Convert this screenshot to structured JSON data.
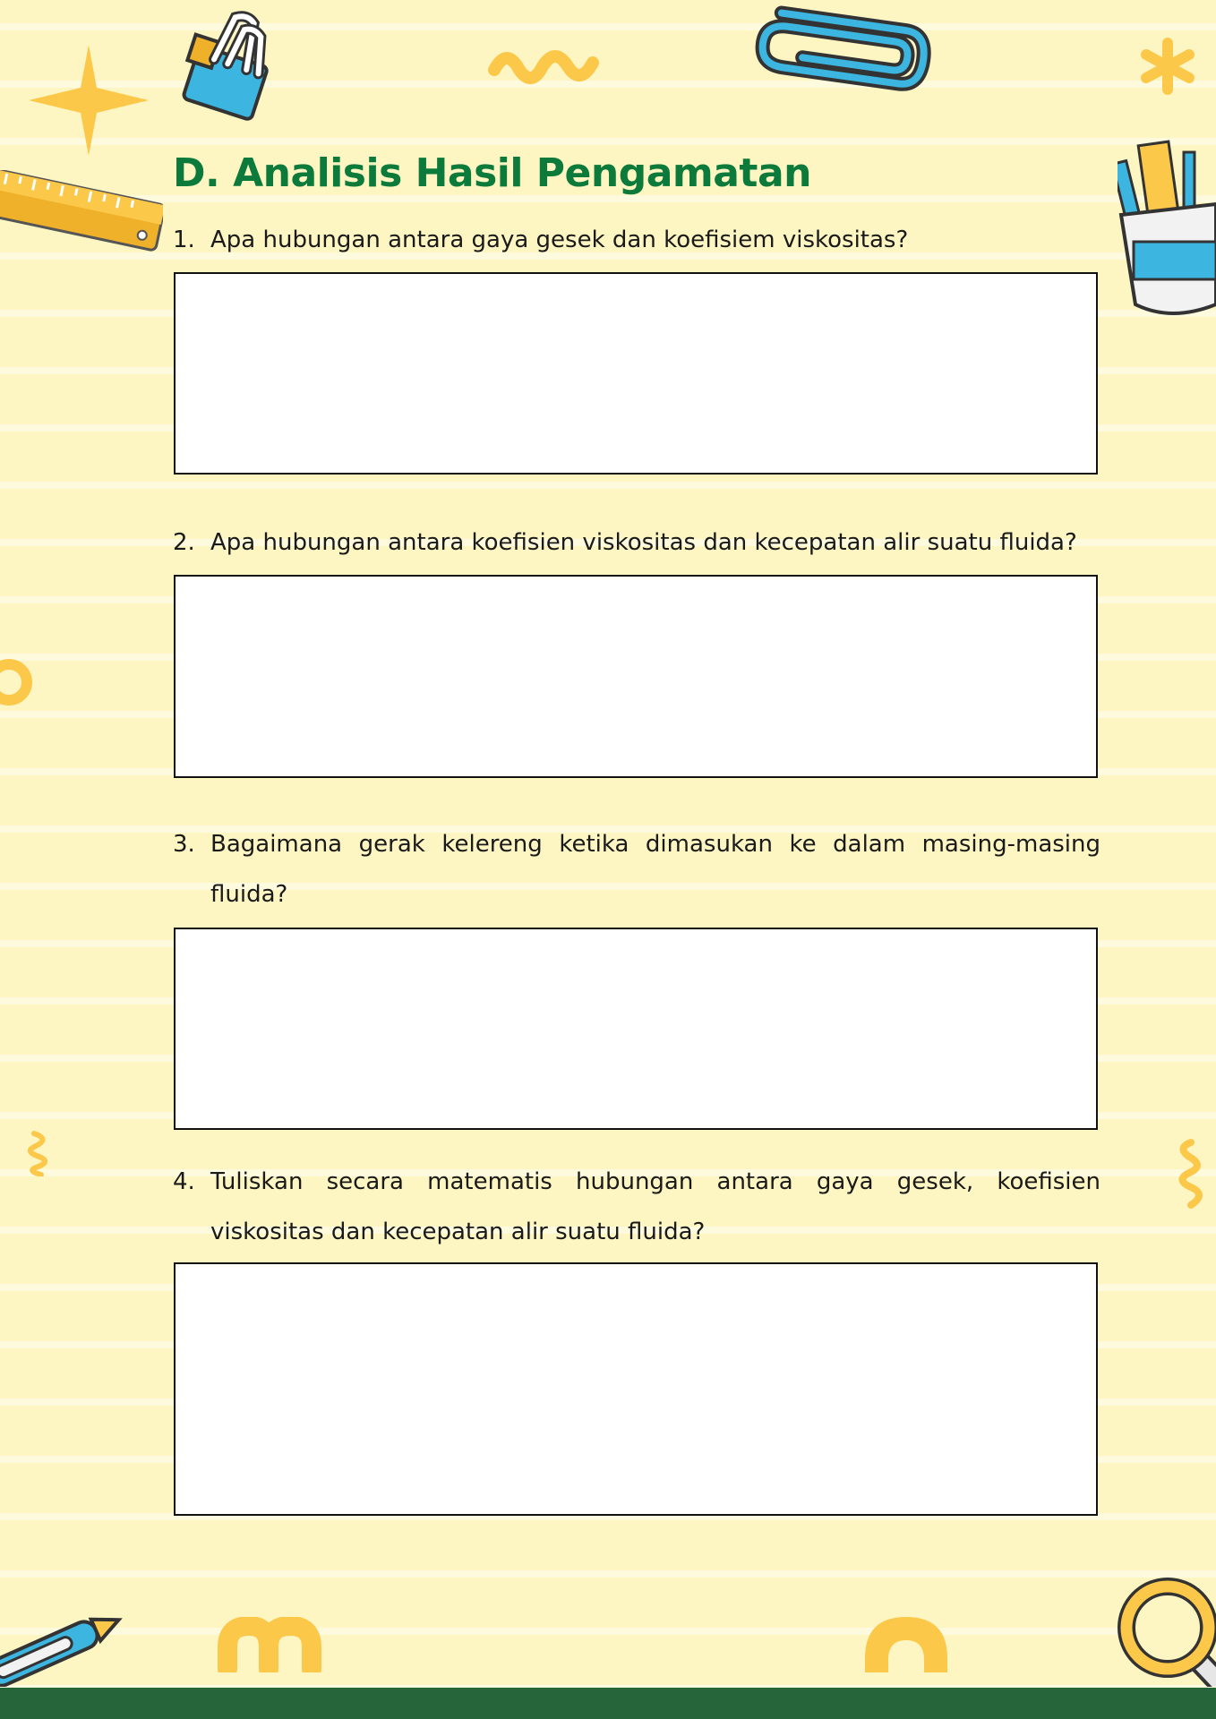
{
  "heading": {
    "prefix": "D.",
    "title": "Analisis Hasil Pengamatan"
  },
  "questions": [
    {
      "number": "1.",
      "text": "Apa hubungan antara gaya gesek dan koefisiem viskositas?",
      "answer": ""
    },
    {
      "number": "2.",
      "text": "Apa hubungan antara koefisien viskositas dan kecepatan alir suatu fluida?",
      "answer": ""
    },
    {
      "number": "3.",
      "text": "Bagaimana gerak kelereng ketika dimasukan ke dalam masing-masing fluida?",
      "answer": ""
    },
    {
      "number": "4.",
      "text": "Tuliskan secara matematis hubungan antara gaya gesek, koefisien viskositas dan kecepatan alir suatu fluida?",
      "answer": ""
    }
  ],
  "colors": {
    "heading": "#0b7a3a",
    "background": "#fdf6c3",
    "accent": "#fcc849",
    "footer": "#266539",
    "clip_blue": "#3cb6e0"
  },
  "decorations": [
    "star-icon",
    "binder-clip-icon",
    "squiggle-icon",
    "paper-clip-icon",
    "asterisk-icon",
    "ruler-icon",
    "pencil-cup-icon",
    "ring-icon",
    "spiral-icon",
    "pen-icon",
    "arch-icon",
    "magnifier-icon"
  ]
}
